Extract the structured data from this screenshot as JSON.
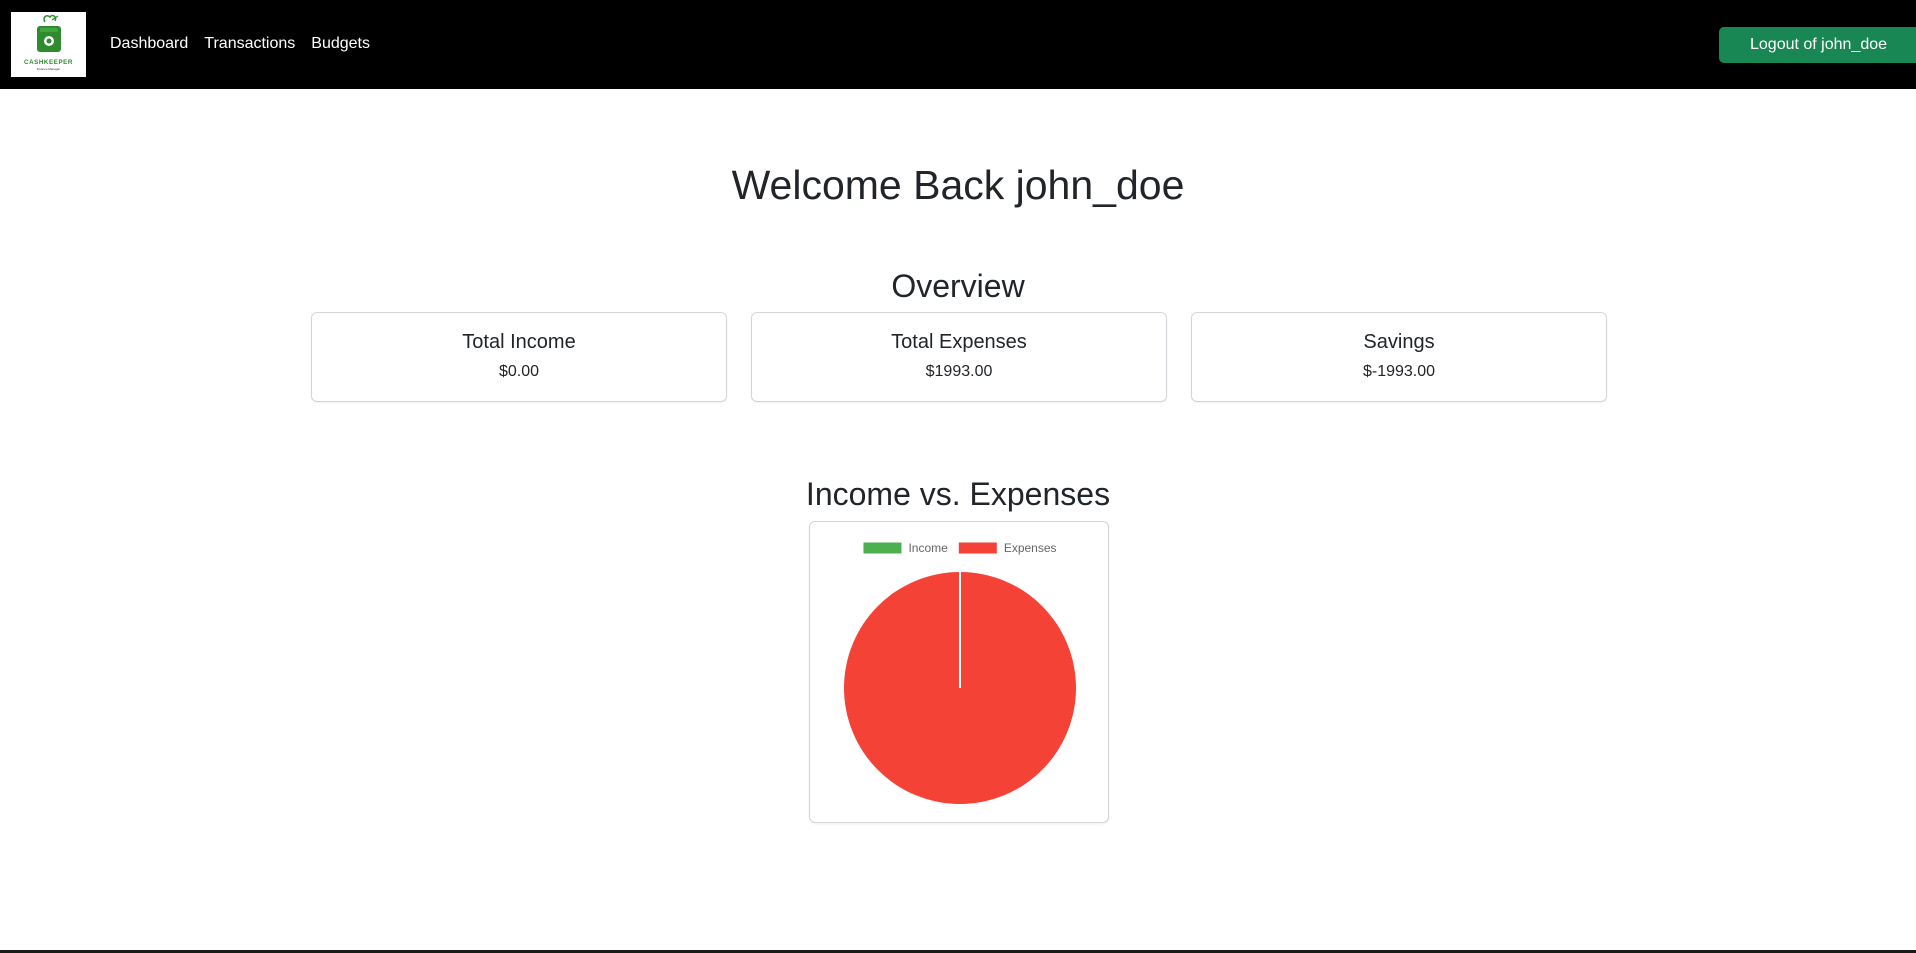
{
  "brand": {
    "name": "CASHKEEPER",
    "tagline": "Finance Manager",
    "color": "#2e8b2e"
  },
  "nav": {
    "links": [
      {
        "label": "Dashboard"
      },
      {
        "label": "Transactions"
      },
      {
        "label": "Budgets"
      }
    ],
    "logout_label": "Logout of john_doe",
    "logout_color": "#198754"
  },
  "welcome": "Welcome Back john_doe",
  "overview": {
    "title": "Overview",
    "cards": [
      {
        "title": "Total Income",
        "value": "$0.00"
      },
      {
        "title": "Total Expenses",
        "value": "$1993.00"
      },
      {
        "title": "Savings",
        "value": "$-1993.00"
      }
    ]
  },
  "chart_section": {
    "title": "Income vs. Expenses"
  },
  "chart_data": {
    "type": "pie",
    "categories": [
      "Income",
      "Expenses"
    ],
    "values": [
      0,
      1993
    ],
    "colors": [
      "#4caf50",
      "#f44336"
    ],
    "legend": "top"
  }
}
